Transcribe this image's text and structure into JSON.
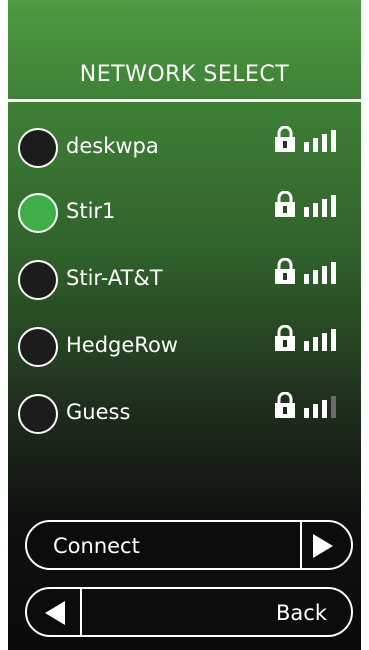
{
  "header": {
    "title": "NETWORK SELECT"
  },
  "networks": [
    {
      "name": "deskwpa",
      "selected": false,
      "secured": true,
      "signal": 4
    },
    {
      "name": "Stir1",
      "selected": true,
      "secured": true,
      "signal": 4
    },
    {
      "name": "Stir-AT&T",
      "selected": false,
      "secured": true,
      "signal": 4
    },
    {
      "name": "HedgeRow",
      "selected": false,
      "secured": true,
      "signal": 4
    },
    {
      "name": "Guess",
      "selected": false,
      "secured": true,
      "signal": 3
    }
  ],
  "buttons": {
    "connect_label": "Connect",
    "back_label": "Back"
  },
  "colors": {
    "accent_green": "#3fae49",
    "text": "#ffffff"
  }
}
